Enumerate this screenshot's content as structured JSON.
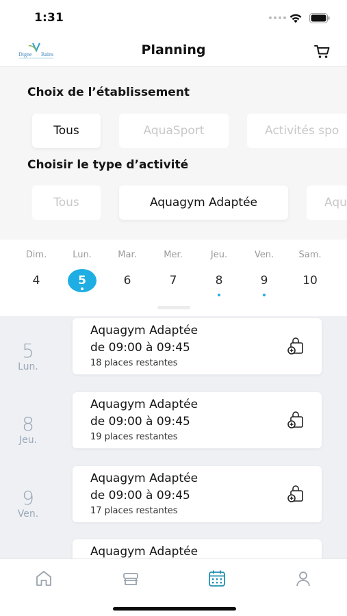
{
  "status": {
    "time": "1:31"
  },
  "header": {
    "title": "Planning",
    "logo_text_top": "Digne",
    "logo_text_bottom": "Bains"
  },
  "filters": {
    "establishment_title": "Choix de l’établissement",
    "establishment_chips": [
      "Tous",
      "AquaSport",
      "Activités spo"
    ],
    "establishment_selected": "Tous",
    "activity_title": "Choisir le type d’activité",
    "activity_chips": [
      "Tous",
      "Aquagym Adaptée",
      "Aqu"
    ],
    "activity_selected": "Aquagym Adaptée"
  },
  "week": {
    "days": [
      {
        "name": "Dim.",
        "num": "4",
        "has_event": false,
        "selected": false
      },
      {
        "name": "Lun.",
        "num": "5",
        "has_event": true,
        "selected": true
      },
      {
        "name": "Mar.",
        "num": "6",
        "has_event": false,
        "selected": false
      },
      {
        "name": "Mer.",
        "num": "7",
        "has_event": false,
        "selected": false
      },
      {
        "name": "Jeu.",
        "num": "8",
        "has_event": true,
        "selected": false
      },
      {
        "name": "Ven.",
        "num": "9",
        "has_event": true,
        "selected": false
      },
      {
        "name": "Sam.",
        "num": "10",
        "has_event": false,
        "selected": false
      }
    ]
  },
  "sessions": [
    {
      "day_num": "5",
      "day_name": "Lun.",
      "title": "Aquagym Adaptée",
      "time": "de 09:00 à 09:45",
      "places": "18 places restantes"
    },
    {
      "day_num": "8",
      "day_name": "Jeu.",
      "title": "Aquagym Adaptée",
      "time": "de 09:00 à 09:45",
      "places": "19 places restantes"
    },
    {
      "day_num": "9",
      "day_name": "Ven.",
      "title": "Aquagym Adaptée",
      "time": "de 09:00 à 09:45",
      "places": "17 places restantes"
    },
    {
      "day_num": "",
      "day_name": "",
      "title": "Aquagym Adaptée",
      "time": "",
      "places": ""
    }
  ],
  "tabs": [
    {
      "icon": "home-icon",
      "active": false
    },
    {
      "icon": "store-icon",
      "active": false
    },
    {
      "icon": "calendar-icon",
      "active": true
    },
    {
      "icon": "profile-icon",
      "active": false
    }
  ],
  "colors": {
    "accent": "#1eaee4",
    "tab_active": "#1f8fb3",
    "tab_inactive": "#9aa3ad",
    "date_label": "#9aa8b8"
  }
}
